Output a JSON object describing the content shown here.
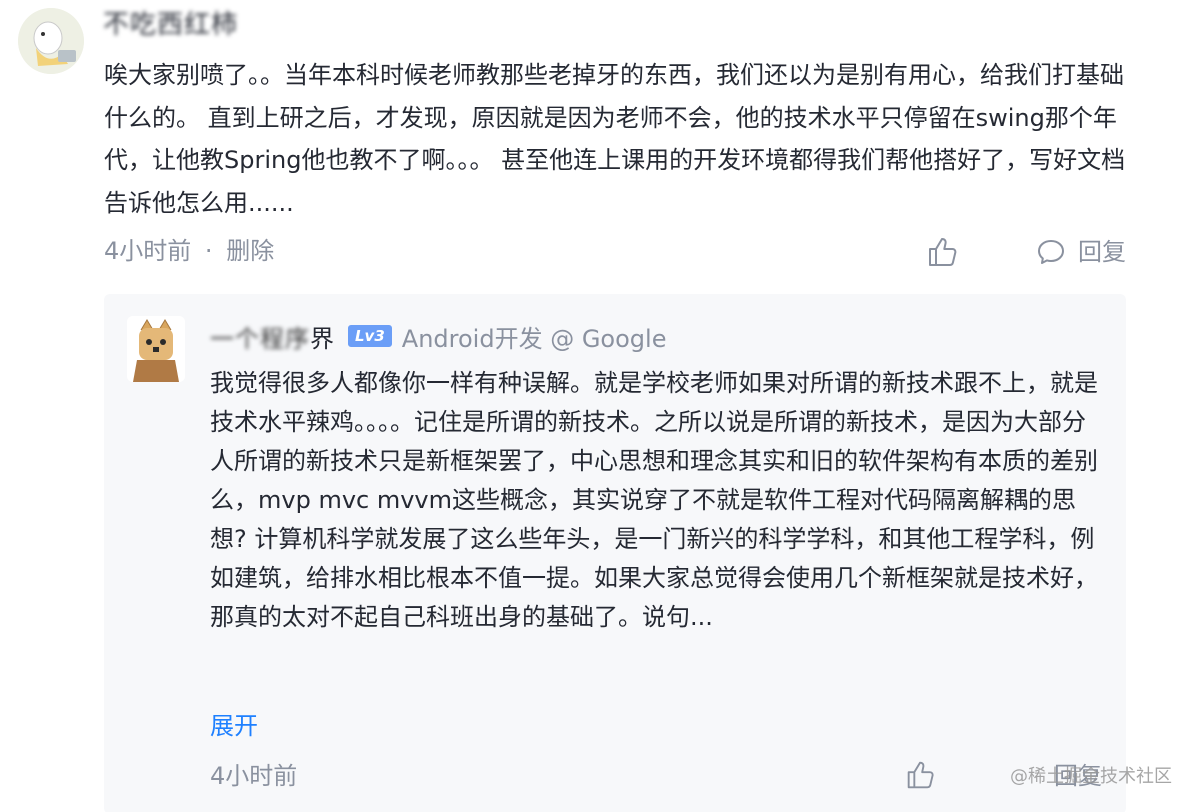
{
  "comment": {
    "username": "不吃西红柿",
    "text": "唉大家别喷了。。当年本科时候老师教那些老掉牙的东西，我们还以为是别有用心，给我们打基础什么的。 直到上研之后，才发现，原因就是因为老师不会，他的技术水平只停留在swing那个年代，让他教Spring他也教不了啊。。。 甚至他连上课用的开发环境都得我们帮他搭好了，写好文档告诉他怎么用......",
    "time": "4小时前",
    "separator": "·",
    "delete_label": "删除",
    "reply_label": "回复"
  },
  "reply": {
    "username_blurred": "一个程序",
    "username_tail": "界",
    "level": "Lv3",
    "job": "Android开发 @ Google",
    "text": "我觉得很多人都像你一样有种误解。就是学校老师如果对所谓的新技术跟不上，就是技术水平辣鸡。。。。记住是所谓的新技术。之所以说是所谓的新技术，是因为大部分人所谓的新技术只是新框架罢了，中心思想和理念其实和旧的软件架构有本质的差别么，mvp mvc mvvm这些概念，其实说穿了不就是软件工程对代码隔离解耦的思想? 计算机科学就发展了这么些年头，是一门新兴的科学学科，和其他工程学科，例如建筑，给排水相比根本不值一提。如果大家总觉得会使用几个新框架就是技术好，那真的太对不起自己科班出身的基础了。说句...",
    "expand_label": "展开",
    "time": "4小时前",
    "reply_label": "回复"
  },
  "watermark": {
    "text": "@稀土掘金技术社区"
  },
  "colors": {
    "text": "#252933",
    "meta": "#8a919f",
    "link": "#1e80ff",
    "reply_bg": "#f7f8fa",
    "badge": "#6b9ef7"
  },
  "icons": [
    "thumbs-up-icon",
    "comment-bubble-icon"
  ]
}
